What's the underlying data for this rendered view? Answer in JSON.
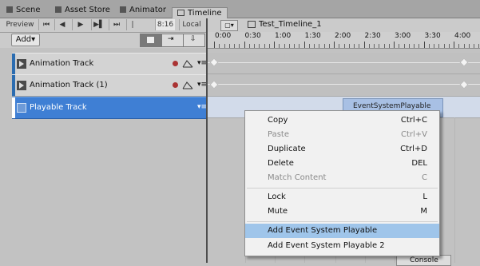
{
  "tabs": [
    {
      "label": "Scene",
      "icon": "grid-icon"
    },
    {
      "label": "Asset Store",
      "icon": "store-icon"
    },
    {
      "label": "Animator",
      "icon": "animator-icon"
    },
    {
      "label": "Timeline",
      "icon": "timeline-icon",
      "active": true
    }
  ],
  "toolbar": {
    "preview": "Preview",
    "frame": "8:16",
    "local": "Local",
    "add": "Add▾",
    "timeline_asset": "Test_Timeline_1"
  },
  "ruler": [
    "0:00",
    "0:30",
    "1:00",
    "1:30",
    "2:00",
    "2:30",
    "3:00",
    "3:30",
    "4:00"
  ],
  "tracks": [
    {
      "label": "Animation Track"
    },
    {
      "label": "Animation Track (1)"
    },
    {
      "label": "Playable Track",
      "selected": true
    }
  ],
  "clip": {
    "label": "EventSystemPlayable"
  },
  "context_menu": {
    "items": [
      {
        "label": "Copy",
        "shortcut": "Ctrl+C"
      },
      {
        "label": "Paste",
        "shortcut": "Ctrl+V",
        "disabled": true
      },
      {
        "label": "Duplicate",
        "shortcut": "Ctrl+D"
      },
      {
        "label": "Delete",
        "shortcut": "DEL"
      },
      {
        "label": "Match Content",
        "shortcut": "C",
        "disabled": true
      },
      {
        "label": "Lock",
        "shortcut": "L"
      },
      {
        "label": "Mute",
        "shortcut": "M"
      },
      {
        "label": "Add Event System Playable",
        "shortcut": "",
        "highlighted": true
      },
      {
        "label": "Add Event System Playable 2",
        "shortcut": ""
      }
    ]
  },
  "console": {
    "label": "Console"
  },
  "colors": {
    "accent": "#3f7fd4",
    "highlight": "#9fc5ea",
    "clip": "#a8c0e4"
  }
}
